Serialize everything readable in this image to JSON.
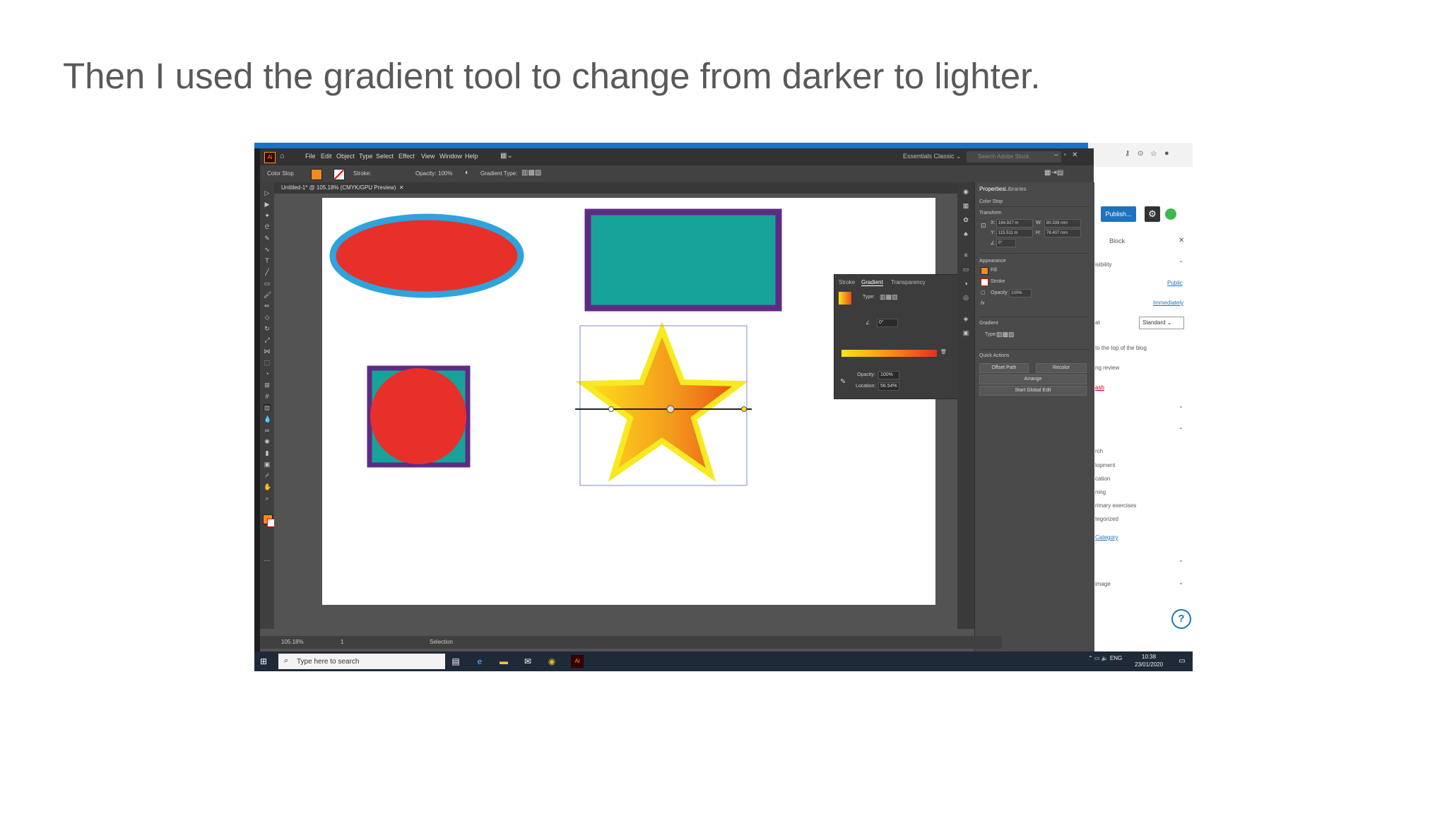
{
  "slide": {
    "title": "Then I used the gradient tool to change from darker to lighter."
  },
  "illustrator": {
    "logo": "Ai",
    "menu": [
      "File",
      "Edit",
      "Object",
      "Type",
      "Select",
      "Effect",
      "View",
      "Window",
      "Help"
    ],
    "workspace": "Essentials Classic",
    "search_placeholder": "Search Adobe Stock",
    "control_bar": {
      "mode": "Color Stop",
      "stroke_label": "Stroke:",
      "opacity_label": "Opacity:",
      "opacity_value": "100%",
      "gradient_type_label": "Gradient Type:"
    },
    "document_tab": "Untitled-1* @ 105.18% (CMYK/GPU Preview)",
    "status": {
      "zoom": "105.18%",
      "artboard": "1",
      "tool": "Selection"
    },
    "gradient_panel": {
      "tabs": [
        "Stroke",
        "Gradient",
        "Transparency"
      ],
      "type_label": "Type:",
      "angle_value": "0°",
      "opacity_label": "Opacity:",
      "opacity_value": "100%",
      "location_label": "Location:",
      "location_value": "56.54%"
    },
    "properties_panel": {
      "tabs": [
        "Properties",
        "Libraries"
      ],
      "section_color_stop": "Color Stop",
      "section_transform": "Transform",
      "x": "164.927 m",
      "y": "115.511 m",
      "w": "80.339 mm",
      "h": "76.407 mm",
      "angle": "0°",
      "section_appearance": "Appearance",
      "fill_label": "Fill",
      "stroke_label": "Stroke",
      "opacity_label": "Opacity",
      "opacity_value": "100%",
      "section_gradient": "Gradient",
      "gradient_type_label": "Type:",
      "section_quick_actions": "Quick Actions",
      "btn_offset_path": "Offset Path",
      "btn_recolor": "Recolor",
      "btn_arrange": "Arrange",
      "btn_global_edit": "Start Global Edit"
    },
    "colors": {
      "ellipse_fill": "#e8302a",
      "ellipse_stroke": "#2ea3dd",
      "rect_fill": "#18a39a",
      "rect_stroke": "#5e2b84",
      "circle_fill": "#e8302a",
      "star_gradient_start": "#ffe21a",
      "star_gradient_end": "#ea4f17"
    }
  },
  "wordpress": {
    "publish": "Publish...",
    "block_tab": "Block",
    "visibility": "isibility",
    "public": "Public",
    "immediately": "Immediately",
    "format_label": "at",
    "format_value": "Standard",
    "sticky": "to the top of the blog",
    "pending": "ng review",
    "trash": "ash",
    "categories": [
      "rch",
      "lopment",
      "cation",
      "ning",
      "rimary exercises",
      "tegorized"
    ],
    "add_category": "Category",
    "featured_image": "image"
  },
  "taskbar": {
    "search_placeholder": "Type here to search",
    "lang": "ENG",
    "time": "10:38",
    "date": "23/01/2020"
  }
}
